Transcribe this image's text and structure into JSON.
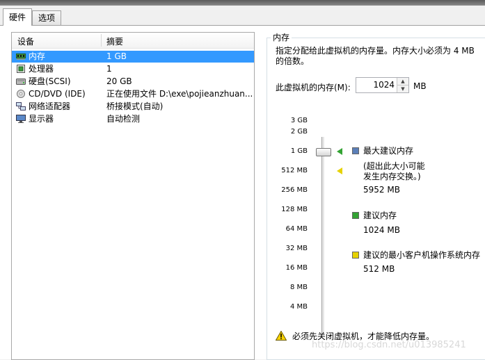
{
  "tabs": [
    "硬件",
    "选项"
  ],
  "table": {
    "headers": [
      "设备",
      "摘要"
    ],
    "rows": [
      {
        "name": "内存",
        "summary": "1 GB",
        "icon": "memory-icon",
        "selected": true
      },
      {
        "name": "处理器",
        "summary": "1",
        "icon": "processor-icon"
      },
      {
        "name": "硬盘(SCSI)",
        "summary": "20 GB",
        "icon": "hard-disk-icon"
      },
      {
        "name": "CD/DVD (IDE)",
        "summary": "正在使用文件 D:\\exe\\pojieanzhuan...",
        "icon": "cd-dvd-icon"
      },
      {
        "name": "网络适配器",
        "summary": "桥接模式(自动)",
        "icon": "network-adapter-icon"
      },
      {
        "name": "显示器",
        "summary": "自动检测",
        "icon": "display-icon"
      }
    ]
  },
  "memory": {
    "group_title": "内存",
    "description": "指定分配给此虚拟机的内存量。内存大小必须为 4 MB 的倍数。",
    "field_label": "此虚拟机的内存(M):",
    "field_value": "1024",
    "unit": "MB",
    "scale": [
      "3 GB",
      "2 GB",
      "1 GB",
      "512 MB",
      "256 MB",
      "128 MB",
      "64 MB",
      "32 MB",
      "16 MB",
      "8 MB",
      "4 MB"
    ],
    "legend": {
      "max_label": "最大建议内存",
      "max_note_1": "(超出此大小可能",
      "max_note_2": "发生内存交换。)",
      "max_value": "5952 MB",
      "rec_label": "建议内存",
      "rec_value": "1024 MB",
      "min_label": "建议的最小客户机操作系统内存",
      "min_value": "512 MB"
    },
    "warning": "必须先关闭虚拟机，才能降低内存量。",
    "colors": {
      "max": "#5b7fb8",
      "rec": "#33a333",
      "min": "#e6d200"
    }
  },
  "watermark": "https://blog.csdn.net/u013985241"
}
